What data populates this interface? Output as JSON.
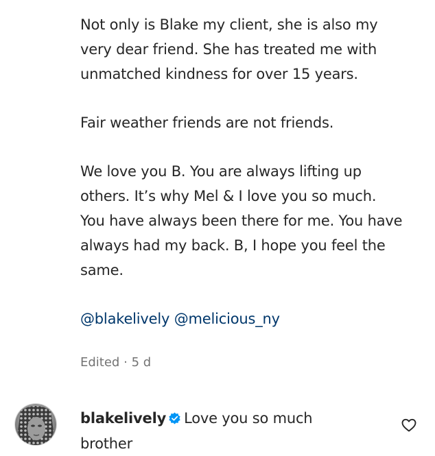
{
  "caption": {
    "paragraphs": [
      "Not only is Blake my client, she is also my very dear friend. She has treated me with unmatched kindness for over 15 years.",
      "Fair weather friends are not friends.",
      "We love you B. You are always lifting up others. It’s why Mel & I love you so much. You have always been there for me. You have always had my back. B, I hope you feel the same."
    ],
    "mentions": [
      "@blakelively",
      "@melicious_ny"
    ]
  },
  "meta": {
    "edited_label": "Edited",
    "separator": "·",
    "time_ago": "5 d"
  },
  "comment": {
    "username": "blakelively",
    "verified": true,
    "text": "Love you so much brother",
    "avatar_icon": "profile-photo",
    "like_icon": "heart-outline-icon"
  },
  "colors": {
    "text": "#262626",
    "mention": "#00376b",
    "meta": "#737373",
    "verified_badge": "#0095f6"
  }
}
